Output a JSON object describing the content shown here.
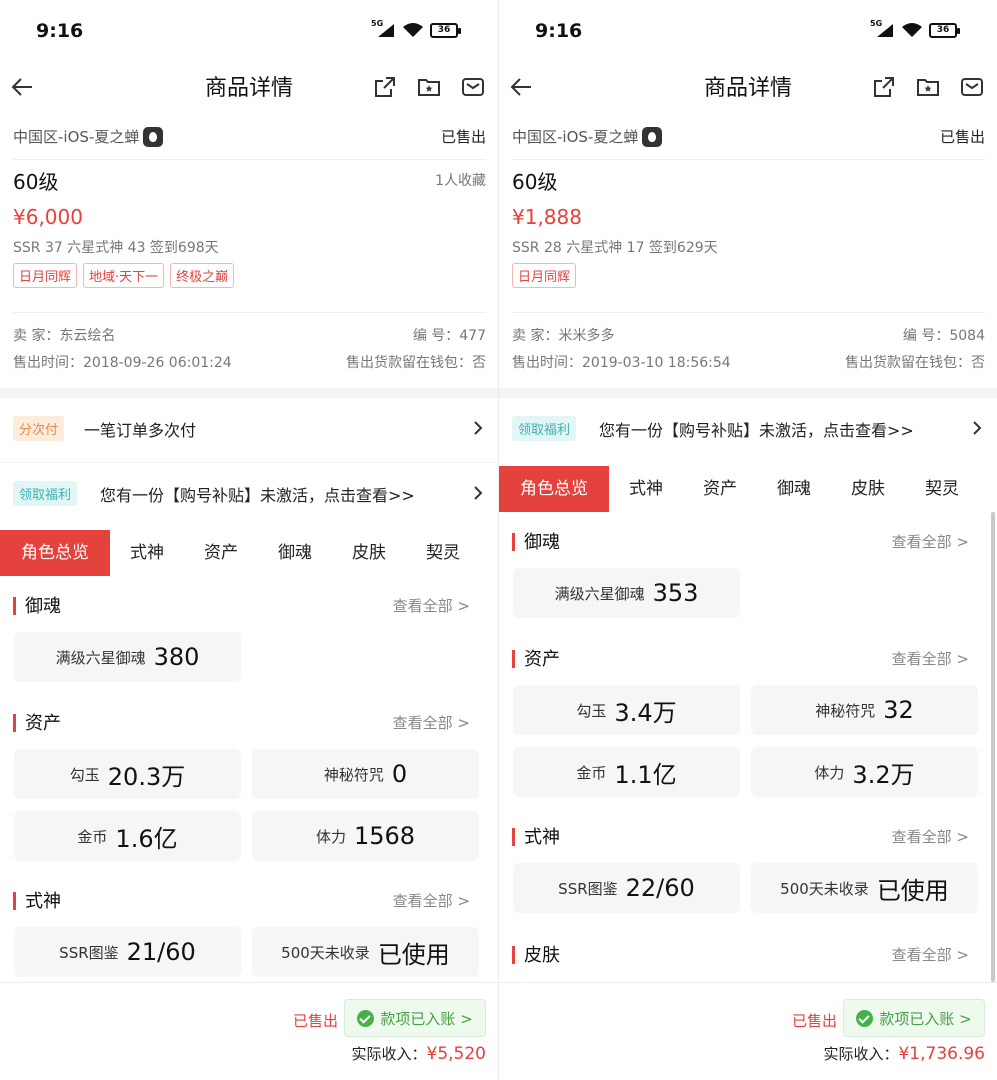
{
  "panels": [
    {
      "time": "9:16",
      "network": "5G",
      "battery": "36",
      "nav": {
        "title": "商品详情"
      },
      "server": "中国区-iOS-夏之蝉",
      "sold_status": "已售出",
      "level": "60级",
      "favorites": "1人收藏",
      "price": "¥6,000",
      "stats": "SSR 37   六星式神 43   签到698天",
      "tags": [
        "日月同辉",
        "地域·天下一",
        "终极之巅"
      ],
      "seller": "卖 家：东云绘名",
      "code": "编 号：477",
      "sold_time": "售出时间：2018-09-26 06:01:24",
      "wallet": "售出货款留在钱包：否",
      "promos": [
        {
          "badge": "分次付",
          "text": "一笔订单多次付"
        },
        {
          "badge": "领取福利",
          "text": "您有一份【购号补贴】未激活，点击查看>>"
        }
      ],
      "tabs": [
        "角色总览",
        "式神",
        "资产",
        "御魂",
        "皮肤",
        "契灵"
      ],
      "sections": [
        {
          "name": "御魂",
          "more": "查看全部 >",
          "cards": [
            {
              "label": "满级六星御魂",
              "value": "380"
            }
          ]
        },
        {
          "name": "资产",
          "more": "查看全部 >",
          "cards": [
            {
              "label": "勾玉",
              "value": "20.3万"
            },
            {
              "label": "神秘符咒",
              "value": "0"
            },
            {
              "label": "金币",
              "value": "1.6亿"
            },
            {
              "label": "体力",
              "value": "1568"
            }
          ]
        },
        {
          "name": "式神",
          "more": "查看全部 >",
          "cards": [
            {
              "label": "SSR图鉴",
              "value": "21/60"
            },
            {
              "label": "500天未收录",
              "value": "已使用"
            }
          ]
        }
      ],
      "footer": {
        "sold": "已售出",
        "paid": "款项已入账 >",
        "income_label": "实际收入：",
        "income": "¥5,520"
      }
    },
    {
      "time": "9:16",
      "network": "5G",
      "battery": "36",
      "nav": {
        "title": "商品详情"
      },
      "server": "中国区-iOS-夏之蝉",
      "sold_status": "已售出",
      "level": "60级",
      "favorites": "",
      "price": "¥1,888",
      "stats": "SSR 28   六星式神 17   签到629天",
      "tags": [
        "日月同辉"
      ],
      "seller": "卖 家：米米多多",
      "code": "编 号：5084",
      "sold_time": "售出时间：2019-03-10 18:56:54",
      "wallet": "售出货款留在钱包：否",
      "promos": [
        {
          "badge": "领取福利",
          "text": "您有一份【购号补贴】未激活，点击查看>>"
        }
      ],
      "tabs": [
        "角色总览",
        "式神",
        "资产",
        "御魂",
        "皮肤",
        "契灵"
      ],
      "sections": [
        {
          "name": "御魂",
          "more": "查看全部 >",
          "cards": [
            {
              "label": "满级六星御魂",
              "value": "353"
            }
          ]
        },
        {
          "name": "资产",
          "more": "查看全部 >",
          "cards": [
            {
              "label": "勾玉",
              "value": "3.4万"
            },
            {
              "label": "神秘符咒",
              "value": "32"
            },
            {
              "label": "金币",
              "value": "1.1亿"
            },
            {
              "label": "体力",
              "value": "3.2万"
            }
          ]
        },
        {
          "name": "式神",
          "more": "查看全部 >",
          "cards": [
            {
              "label": "SSR图鉴",
              "value": "22/60"
            },
            {
              "label": "500天未收录",
              "value": "已使用"
            }
          ]
        },
        {
          "name": "皮肤",
          "more": "查看全部 >",
          "cards": []
        }
      ],
      "footer": {
        "sold": "已售出",
        "paid": "款项已入账 >",
        "income_label": "实际收入：",
        "income": "¥1,736.96"
      }
    }
  ],
  "colors": {
    "accent": "#e5413d",
    "success": "#46b14a",
    "card": "#f6f6f6"
  },
  "icons": [
    "back-arrow-icon",
    "share-icon",
    "favorite-folder-icon",
    "mail-icon",
    "chevron-right-icon",
    "check-circle-icon",
    "apple-logo-icon"
  ]
}
